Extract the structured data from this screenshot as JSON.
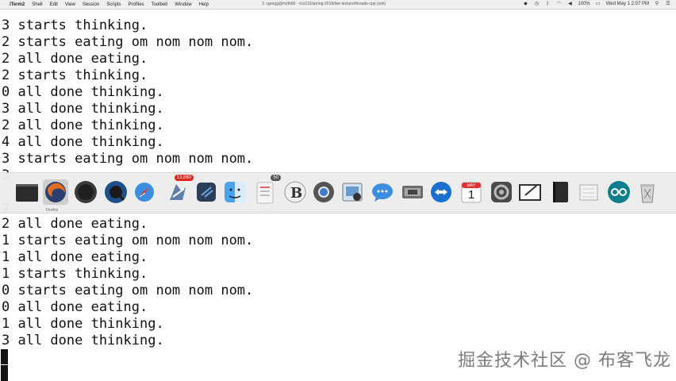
{
  "menubar": {
    "apple_icon": "apple-icon",
    "items": [
      "iTerm2",
      "Shell",
      "Edit",
      "View",
      "Session",
      "Scripts",
      "Profiles",
      "Toolbelt",
      "Window",
      "Help"
    ],
    "window_title": "3. cgregg@myth66: ~/cs110/spring-2019/live-lecture/threads-cpp (ssh)",
    "battery": "100%",
    "clock": "Wed May 1 2:07 PM"
  },
  "terminal": {
    "lines_top": [
      "3 starts thinking.",
      "2 starts eating om nom nom nom.",
      "2 all done eating.",
      "2 starts thinking.",
      "0 all done thinking.",
      "3 all done thinking.",
      "2 all done thinking.",
      "4 all done thinking.",
      "3 starts eating om nom nom nom.",
      "3"
    ],
    "lines_bottom": [
      "2",
      "2 all done eating.",
      "1 starts eating om nom nom nom.",
      "1 all done eating.",
      "1 starts thinking.",
      "0 starts eating om nom nom nom.",
      "0 all done eating.",
      "1 all done thinking.",
      "3 all done thinking."
    ]
  },
  "dock": {
    "items": [
      {
        "name": "terminal-app-icon",
        "badge": ""
      },
      {
        "name": "firefox-icon",
        "badge": ""
      },
      {
        "name": "dark-app-icon",
        "badge": ""
      },
      {
        "name": "quicktime-icon",
        "badge": ""
      },
      {
        "name": "safari-icon",
        "badge": ""
      },
      {
        "name": "mail-icon",
        "badge": "13,880"
      },
      {
        "name": "xcode-tools-icon",
        "badge": ""
      },
      {
        "name": "finder-icon",
        "badge": ""
      },
      {
        "name": "notes-icon",
        "badge": "50"
      },
      {
        "name": "bbedit-icon",
        "badge": ""
      },
      {
        "name": "chrome-icon",
        "badge": ""
      },
      {
        "name": "preview-icon",
        "badge": ""
      },
      {
        "name": "messages-icon",
        "badge": ""
      },
      {
        "name": "photos-icon",
        "badge": ""
      },
      {
        "name": "teamviewer-icon",
        "badge": ""
      },
      {
        "name": "calendar-icon",
        "badge": ""
      },
      {
        "name": "system-prefs-icon",
        "badge": ""
      },
      {
        "name": "whiteboard-icon",
        "badge": ""
      },
      {
        "name": "notebook-icon",
        "badge": ""
      },
      {
        "name": "paper-icon",
        "badge": ""
      },
      {
        "name": "arduino-icon",
        "badge": ""
      },
      {
        "name": "trash-icon",
        "badge": ""
      }
    ],
    "calendar_month": "MAY",
    "calendar_day": "1",
    "tooltip": "Firefox"
  },
  "watermark": "掘金技术社区 @ 布客飞龙"
}
